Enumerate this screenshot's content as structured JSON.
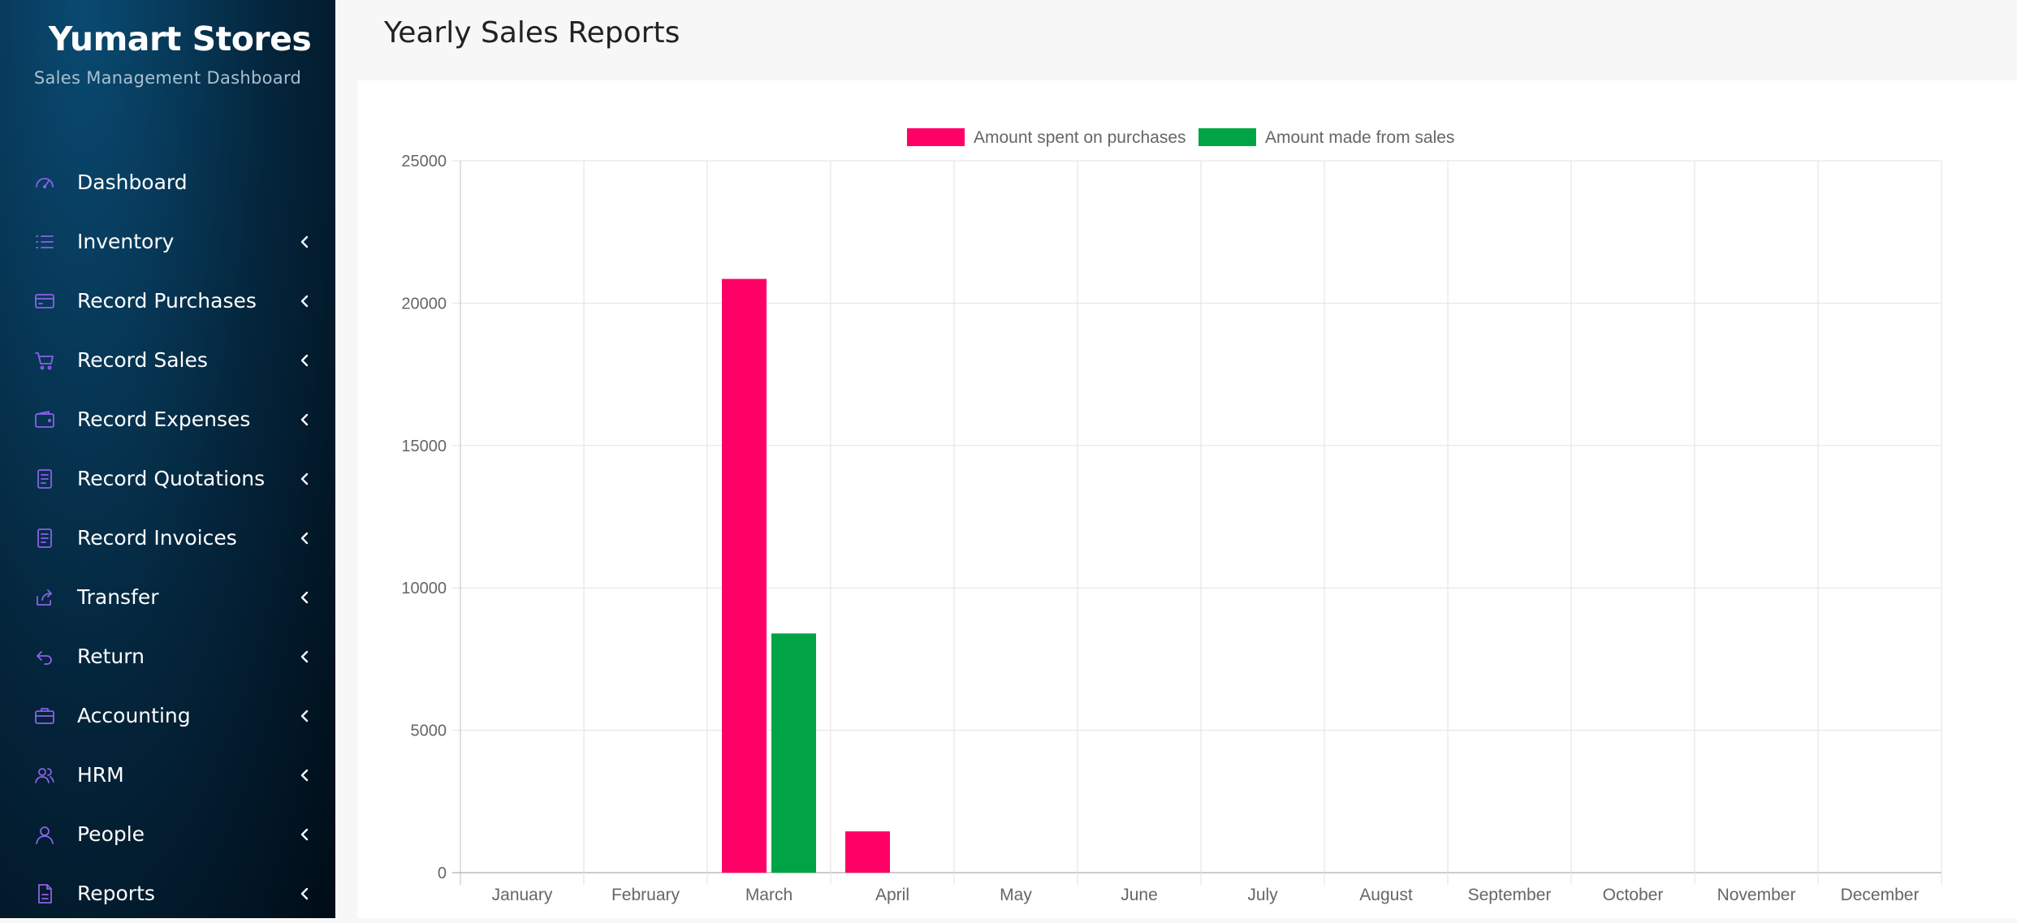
{
  "sidebar": {
    "brand_title": "Yumart Stores",
    "brand_subtitle": "Sales Management Dashboard",
    "items": [
      {
        "label": "Dashboard",
        "icon": "gauge-icon",
        "has_chevron": false
      },
      {
        "label": "Inventory",
        "icon": "list-icon",
        "has_chevron": true
      },
      {
        "label": "Record Purchases",
        "icon": "credit-card-icon",
        "has_chevron": true
      },
      {
        "label": "Record Sales",
        "icon": "cart-icon",
        "has_chevron": true
      },
      {
        "label": "Record Expenses",
        "icon": "wallet-icon",
        "has_chevron": true
      },
      {
        "label": "Record Quotations",
        "icon": "document-icon",
        "has_chevron": true
      },
      {
        "label": "Record Invoices",
        "icon": "invoice-icon",
        "has_chevron": true
      },
      {
        "label": "Transfer",
        "icon": "share-icon",
        "has_chevron": true
      },
      {
        "label": "Return",
        "icon": "return-icon",
        "has_chevron": true
      },
      {
        "label": "Accounting",
        "icon": "briefcase-icon",
        "has_chevron": true
      },
      {
        "label": "HRM",
        "icon": "users-icon",
        "has_chevron": true
      },
      {
        "label": "People",
        "icon": "user-icon",
        "has_chevron": true
      },
      {
        "label": "Reports",
        "icon": "file-icon",
        "has_chevron": true
      }
    ],
    "icon_color": "#8b62e8"
  },
  "header": {
    "title": "Yearly Sales Reports"
  },
  "chart_data": {
    "type": "bar",
    "categories": [
      "January",
      "February",
      "March",
      "April",
      "May",
      "June",
      "July",
      "August",
      "September",
      "October",
      "November",
      "December"
    ],
    "series": [
      {
        "name": "Amount spent on purchases",
        "color": "#ff0066",
        "values": [
          0,
          0,
          20850,
          1450,
          0,
          0,
          0,
          0,
          0,
          0,
          0,
          0
        ]
      },
      {
        "name": "Amount made from sales",
        "color": "#00a444",
        "values": [
          0,
          0,
          8400,
          0,
          0,
          0,
          0,
          0,
          0,
          0,
          0,
          0
        ]
      }
    ],
    "ylim": [
      0,
      25000
    ],
    "yticks": [
      0,
      5000,
      10000,
      15000,
      20000,
      25000
    ],
    "grid": true,
    "legend_position": "top"
  }
}
